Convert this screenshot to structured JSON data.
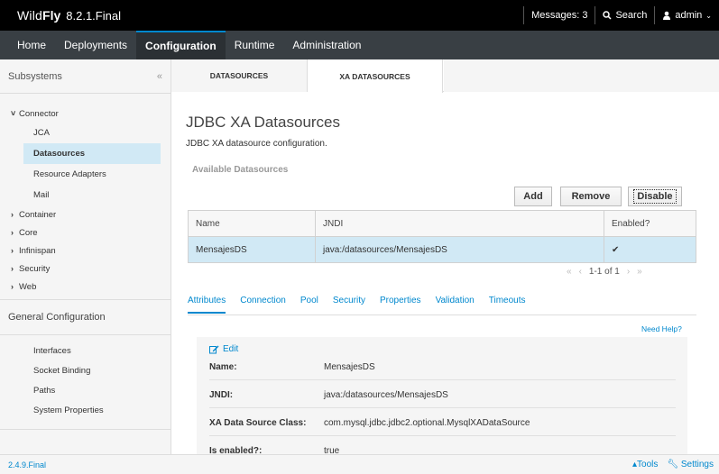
{
  "header": {
    "brand_wild": "Wild",
    "brand_fly": "Fly",
    "version": "8.2.1.Final",
    "messages": "Messages: 3",
    "search": "Search",
    "user": "admin"
  },
  "nav": {
    "items": [
      "Home",
      "Deployments",
      "Configuration",
      "Runtime",
      "Administration"
    ],
    "active": "Configuration"
  },
  "sidebar": {
    "title": "Subsystems",
    "collapse": "«",
    "tree": {
      "connector": "Connector",
      "jca": "JCA",
      "datasources": "Datasources",
      "resource_adapters": "Resource Adapters",
      "mail": "Mail",
      "container": "Container",
      "core": "Core",
      "infinispan": "Infinispan",
      "security": "Security",
      "web": "Web"
    },
    "general_title": "General Configuration",
    "links": [
      "Interfaces",
      "Socket Binding",
      "Paths",
      "System Properties"
    ]
  },
  "tabs": {
    "datasources": "DATASOURCES",
    "xa_datasources": "XA DATASOURCES"
  },
  "main": {
    "title": "JDBC XA Datasources",
    "description": "JDBC XA datasource configuration.",
    "available": "Available Datasources",
    "buttons": {
      "add": "Add",
      "remove": "Remove",
      "disable": "Disable"
    },
    "table": {
      "headers": [
        "Name",
        "JNDI",
        "Enabled?"
      ],
      "rows": [
        {
          "name": "MensajesDS",
          "jndi": "java:/datasources/MensajesDS",
          "enabled": "✔"
        }
      ]
    },
    "pager": {
      "info": "1-1 of 1"
    },
    "subtabs": [
      "Attributes",
      "Connection",
      "Pool",
      "Security",
      "Properties",
      "Validation",
      "Timeouts"
    ],
    "help": "Need Help?",
    "edit": "Edit",
    "details": [
      {
        "key": "Name:",
        "value": "MensajesDS"
      },
      {
        "key": "JNDI:",
        "value": "java:/datasources/MensajesDS"
      },
      {
        "key": "XA Data Source Class:",
        "value": "com.mysql.jdbc.jdbc2.optional.MysqlXADataSource"
      },
      {
        "key": "Is enabled?:",
        "value": "true"
      }
    ]
  },
  "footer": {
    "version": "2.4.9.Final",
    "tools": "Tools",
    "settings": "Settings"
  },
  "colors": {
    "accent": "#0088ce",
    "selected_row": "#d1e9f5",
    "nav_bg": "#393f44",
    "top_bg": "#000000"
  }
}
